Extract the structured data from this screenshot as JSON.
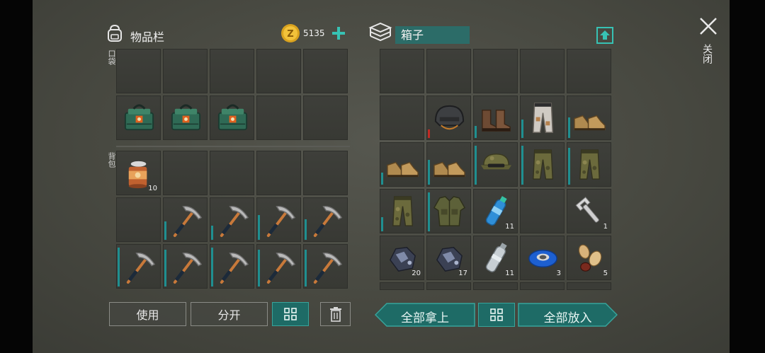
{
  "inventory": {
    "title": "物品栏",
    "coins": "5135",
    "pocket_label": "口袋",
    "backpack_label": "背包",
    "pocket_rows": [
      [
        null,
        null,
        null,
        null,
        null
      ],
      [
        {
          "icon": "crate-icon"
        },
        {
          "icon": "crate-icon"
        },
        {
          "icon": "crate-icon"
        },
        null,
        null
      ]
    ],
    "backpack_rows": [
      [
        {
          "icon": "can-icon",
          "count": "10"
        },
        null,
        null,
        null,
        null
      ],
      [
        null,
        {
          "icon": "pickaxe-icon",
          "cond": 0.45
        },
        {
          "icon": "pickaxe-icon",
          "cond": 0.35
        },
        {
          "icon": "pickaxe-icon",
          "cond": 0.6
        },
        {
          "icon": "pickaxe-icon",
          "cond": 0.5
        }
      ],
      [
        {
          "icon": "pickaxe-icon",
          "cond": 0.95
        },
        {
          "icon": "pickaxe-icon",
          "cond": 0.9
        },
        {
          "icon": "pickaxe-icon",
          "cond": 0.95
        },
        {
          "icon": "pickaxe-icon",
          "cond": 0.9
        },
        {
          "icon": "pickaxe-icon",
          "cond": 0.9
        }
      ]
    ],
    "buttons": {
      "use": "使用",
      "split": "分开"
    }
  },
  "box": {
    "title": "箱子",
    "rows": [
      [
        null,
        null,
        null,
        null,
        null
      ],
      [
        null,
        {
          "icon": "helmet-icon",
          "cond": 0.2,
          "cond_color": "#c02a24"
        },
        {
          "icon": "boots-brown-icon",
          "cond": 0.3
        },
        {
          "icon": "pants-white-icon",
          "cond": 0.45
        },
        {
          "icon": "boots-tan-icon",
          "cond": 0.5
        }
      ],
      [
        {
          "icon": "boots-tan-icon",
          "cond": 0.3
        },
        {
          "icon": "boots-tan-icon",
          "cond": 0.6
        },
        {
          "icon": "cap-camo-icon",
          "cond": 0.95
        },
        {
          "icon": "pants-camo-icon",
          "cond": 0.95
        },
        {
          "icon": "pants-camo-icon",
          "cond": 0.9
        }
      ],
      [
        {
          "icon": "pants-camo-icon",
          "cond": 0.35
        },
        {
          "icon": "jacket-camo-icon",
          "cond": 0.95
        },
        {
          "icon": "water-bottle-icon",
          "count": "11"
        },
        null,
        {
          "icon": "wrench-icon",
          "count": "1"
        }
      ],
      [
        {
          "icon": "ore-icon",
          "count": "20"
        },
        {
          "icon": "ore-icon",
          "count": "17"
        },
        {
          "icon": "empty-bottle-icon",
          "count": "11"
        },
        {
          "icon": "tape-icon",
          "count": "3"
        },
        {
          "icon": "seeds-icon",
          "count": "5"
        }
      ]
    ],
    "buttons": {
      "take_all": "全部拿上",
      "put_all": "全部放入"
    }
  },
  "close_label": "关闭",
  "colors": {
    "accent": "#1e6b66",
    "accent_border": "#37a49b",
    "condition": "#1f8f90",
    "damaged": "#c02a24"
  }
}
